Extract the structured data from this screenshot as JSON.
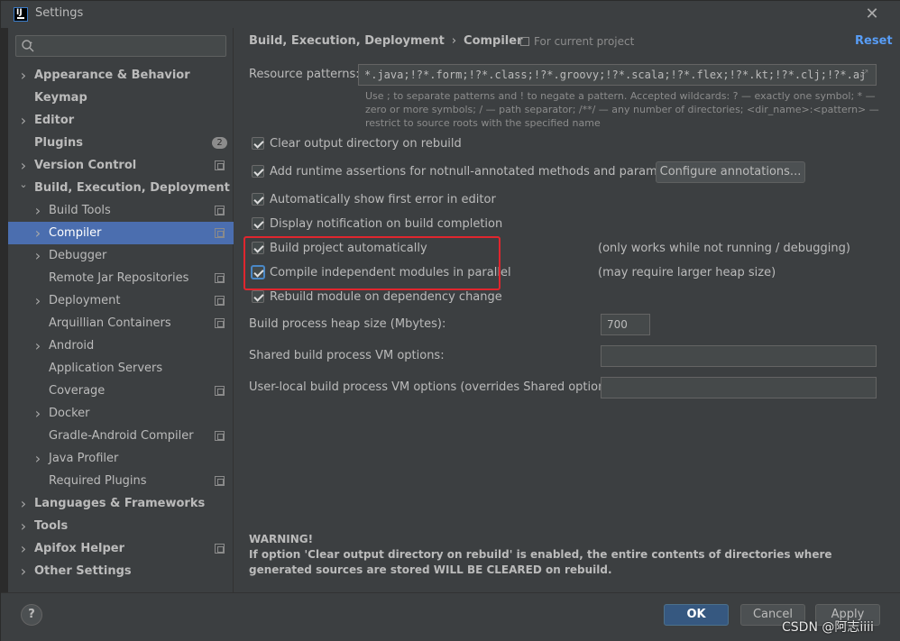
{
  "window": {
    "title": "Settings",
    "app_icon": "intellij-icon",
    "close_icon": "close-icon",
    "close_glyph": "✕"
  },
  "search": {
    "placeholder": "",
    "icon": "search-icon"
  },
  "sidebar": {
    "items": [
      {
        "label": "Appearance & Behavior",
        "level": 0,
        "chevron": "right",
        "project": false
      },
      {
        "label": "Keymap",
        "level": 0,
        "chevron": "none",
        "project": false
      },
      {
        "label": "Editor",
        "level": 0,
        "chevron": "right",
        "project": false
      },
      {
        "label": "Plugins",
        "level": 0,
        "chevron": "none",
        "project": false,
        "badge": "2"
      },
      {
        "label": "Version Control",
        "level": 0,
        "chevron": "right",
        "project": true
      },
      {
        "label": "Build, Execution, Deployment",
        "level": 0,
        "chevron": "down",
        "project": false
      },
      {
        "label": "Build Tools",
        "level": 1,
        "chevron": "right",
        "project": true
      },
      {
        "label": "Compiler",
        "level": 1,
        "chevron": "right",
        "project": true,
        "selected": true
      },
      {
        "label": "Debugger",
        "level": 1,
        "chevron": "right",
        "project": false
      },
      {
        "label": "Remote Jar Repositories",
        "level": 1,
        "chevron": "none",
        "project": true
      },
      {
        "label": "Deployment",
        "level": 1,
        "chevron": "right",
        "project": true
      },
      {
        "label": "Arquillian Containers",
        "level": 1,
        "chevron": "none",
        "project": true
      },
      {
        "label": "Android",
        "level": 1,
        "chevron": "right",
        "project": false
      },
      {
        "label": "Application Servers",
        "level": 1,
        "chevron": "none",
        "project": false
      },
      {
        "label": "Coverage",
        "level": 1,
        "chevron": "none",
        "project": true
      },
      {
        "label": "Docker",
        "level": 1,
        "chevron": "right",
        "project": false
      },
      {
        "label": "Gradle-Android Compiler",
        "level": 1,
        "chevron": "none",
        "project": true
      },
      {
        "label": "Java Profiler",
        "level": 1,
        "chevron": "right",
        "project": false
      },
      {
        "label": "Required Plugins",
        "level": 1,
        "chevron": "none",
        "project": true
      },
      {
        "label": "Languages & Frameworks",
        "level": 0,
        "chevron": "right",
        "project": false
      },
      {
        "label": "Tools",
        "level": 0,
        "chevron": "right",
        "project": false
      },
      {
        "label": "Apifox Helper",
        "level": 0,
        "chevron": "right",
        "project": true
      },
      {
        "label": "Other Settings",
        "level": 0,
        "chevron": "right",
        "project": false
      }
    ]
  },
  "header": {
    "breadcrumb_parent": "Build, Execution, Deployment",
    "breadcrumb_sep": "›",
    "breadcrumb_current": "Compiler",
    "scope_hint": "For current project",
    "reset_label": "Reset"
  },
  "resource": {
    "label": "Resource patterns:",
    "value": "*.java;!?*.form;!?*.class;!?*.groovy;!?*.scala;!?*.flex;!?*.kt;!?*.clj;!?*.aj",
    "help": "Use ; to separate patterns and ! to negate a pattern. Accepted wildcards: ? — exactly one symbol; * — zero or more symbols; / — path separator; /**/ — any number of directories; <dir_name>:<pattern> — restrict to source roots with the specified name"
  },
  "options": [
    {
      "label": "Clear output directory on rebuild",
      "checked": true
    },
    {
      "label": "Add runtime assertions for notnull-annotated methods and parameters",
      "checked": true
    },
    {
      "label": "Automatically show first error in editor",
      "checked": true
    },
    {
      "label": "Display notification on build completion",
      "checked": true
    },
    {
      "label": "Build project automatically",
      "checked": true,
      "note": "(only works while not running / debugging)"
    },
    {
      "label": "Compile independent modules in parallel",
      "checked": true,
      "note": "(may require larger heap size)"
    },
    {
      "label": "Rebuild module on dependency change",
      "checked": true
    }
  ],
  "configure_label": "Configure annotations...",
  "heap": {
    "label": "Build process heap size (Mbytes):",
    "value": "700"
  },
  "shared_vm": {
    "label": "Shared build process VM options:",
    "value": ""
  },
  "userlocal_vm": {
    "label": "User-local build process VM options (overrides Shared options):",
    "value": ""
  },
  "warning": {
    "title": "WARNING!",
    "text": "If option 'Clear output directory on rebuild' is enabled, the entire contents of directories where generated sources are stored WILL BE CLEARED on rebuild."
  },
  "footer": {
    "help_label": "?",
    "ok_label": "OK",
    "cancel_label": "Cancel",
    "apply_label": "Apply"
  },
  "watermark": "CSDN @阿志iiii",
  "colors": {
    "selection": "#4b6eaf",
    "link": "#589df6",
    "highlight": "#e0262e",
    "ok_button": "#365880"
  }
}
